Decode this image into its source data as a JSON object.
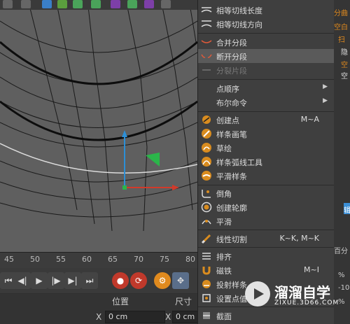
{
  "ruler": {
    "ticks": [
      "45",
      "50",
      "55",
      "60",
      "65",
      "70",
      "75",
      "80"
    ]
  },
  "attributes": {
    "position_label": "位置",
    "size_label": "尺寸",
    "x_label": "X",
    "x_value": "0 cm",
    "size_x_label": "X",
    "size_x_value": "0 cm"
  },
  "menu": {
    "items": [
      {
        "label": "相等切线长度",
        "shortcut": ""
      },
      {
        "label": "相等切线方向",
        "shortcut": ""
      },
      {
        "label": "合并分段",
        "shortcut": ""
      },
      {
        "label": "断开分段",
        "shortcut": ""
      },
      {
        "label": "分裂片段",
        "shortcut": ""
      },
      {
        "label": "点顺序",
        "shortcut": ""
      },
      {
        "label": "布尔命令",
        "shortcut": ""
      },
      {
        "label": "创建点",
        "shortcut": "M~A"
      },
      {
        "label": "样条画笔",
        "shortcut": ""
      },
      {
        "label": "草绘",
        "shortcut": ""
      },
      {
        "label": "样条弧线工具",
        "shortcut": ""
      },
      {
        "label": "平滑样条",
        "shortcut": ""
      },
      {
        "label": "倒角",
        "shortcut": ""
      },
      {
        "label": "创建轮廓",
        "shortcut": ""
      },
      {
        "label": "平滑",
        "shortcut": ""
      },
      {
        "label": "线性切割",
        "shortcut": "K~K, M~K"
      },
      {
        "label": "排齐",
        "shortcut": ""
      },
      {
        "label": "磁铁",
        "shortcut": "M~I"
      },
      {
        "label": "投射样条",
        "shortcut": ""
      },
      {
        "label": "设置点值",
        "shortcut": ""
      },
      {
        "label": "截面",
        "shortcut": ""
      }
    ]
  },
  "right_panel": {
    "texts": [
      "分曲",
      "空白",
      "扫",
      "隐",
      "空",
      "空",
      "辑",
      "百分",
      "%",
      "-10",
      "%"
    ]
  },
  "watermark": {
    "title": "溜溜自学",
    "subtitle": "ZIXUE.3D66.COM"
  },
  "colors": {
    "menu_bg": "#3f3f3f",
    "highlight": "#5a5a5a",
    "accent_orange": "#e08a1e",
    "axis_y": "#2d8fd6",
    "axis_x": "#d23a2a",
    "axis_z": "#2bb54a"
  }
}
